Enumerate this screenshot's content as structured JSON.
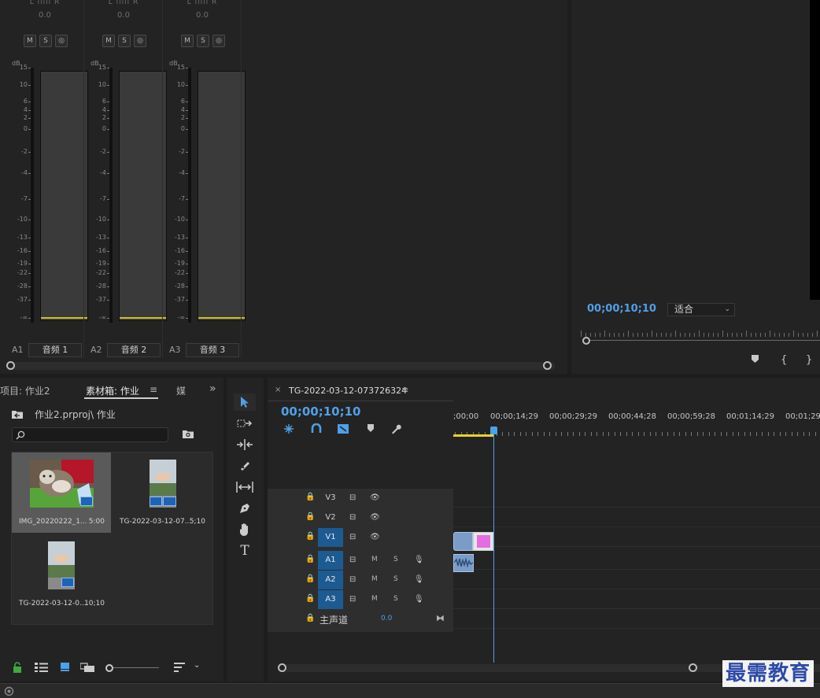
{
  "mixer": {
    "lr_label": "L ılııl R",
    "channels": [
      {
        "pan": "0.0",
        "label": "A1",
        "name": "音频 1"
      },
      {
        "pan": "0.0",
        "label": "A2",
        "name": "音频 2"
      },
      {
        "pan": "0.0",
        "label": "A3",
        "name": "音频 3"
      }
    ],
    "buttons": [
      "M",
      "S",
      "◎"
    ],
    "db_title": "dB",
    "scale": [
      "15",
      "10",
      "6",
      "4",
      "2",
      "0",
      "-2",
      "-4",
      "-7",
      "-10",
      "-13",
      "-16",
      "-19",
      "-22",
      "-28",
      "-37",
      "-∞"
    ]
  },
  "program": {
    "timecode": "00;00;10;10",
    "fit": "适合",
    "controls": [
      "marker-icon",
      "in-point-icon",
      "out-point-icon"
    ]
  },
  "project": {
    "tabs": [
      {
        "label": "项目: 作业2",
        "active": false
      },
      {
        "label": "素材箱: 作业",
        "active": true
      },
      {
        "label": "媒",
        "active": false
      }
    ],
    "tab_menu": "≡",
    "overflow": "»",
    "path": "作业2.prproj\\ 作业",
    "search_placeholder": "",
    "clips": [
      {
        "name": "IMG_20220222_1...",
        "duration": "5:00",
        "selected": true
      },
      {
        "name": "TG-2022-03-12-07...",
        "duration": "5;10",
        "selected": false
      },
      {
        "name": "TG-2022-03-12-0...",
        "duration": "10;10",
        "selected": false
      }
    ]
  },
  "tools": [
    "selection-tool",
    "track-select-tool",
    "ripple-edit-tool",
    "razor-tool",
    "slip-tool",
    "pen-tool",
    "hand-tool",
    "type-tool"
  ],
  "timeline": {
    "tab_title": "TG-2022-03-12-073726324",
    "close": "×",
    "menu": "≡",
    "timecode": "00;00;10;10",
    "ruler": [
      ";00;00",
      "00;00;14;29",
      "00;00;29;29",
      "00;00;44;28",
      "00;00;59;28",
      "00;01;14;29",
      "00;01;29"
    ],
    "video_tracks": [
      "V3",
      "V2",
      "V1"
    ],
    "audio_tracks": [
      "A1",
      "A2",
      "A3"
    ],
    "mute": "M",
    "solo": "S",
    "master": {
      "label": "主声道",
      "value": "0.0"
    }
  },
  "watermark": "最需教育"
}
